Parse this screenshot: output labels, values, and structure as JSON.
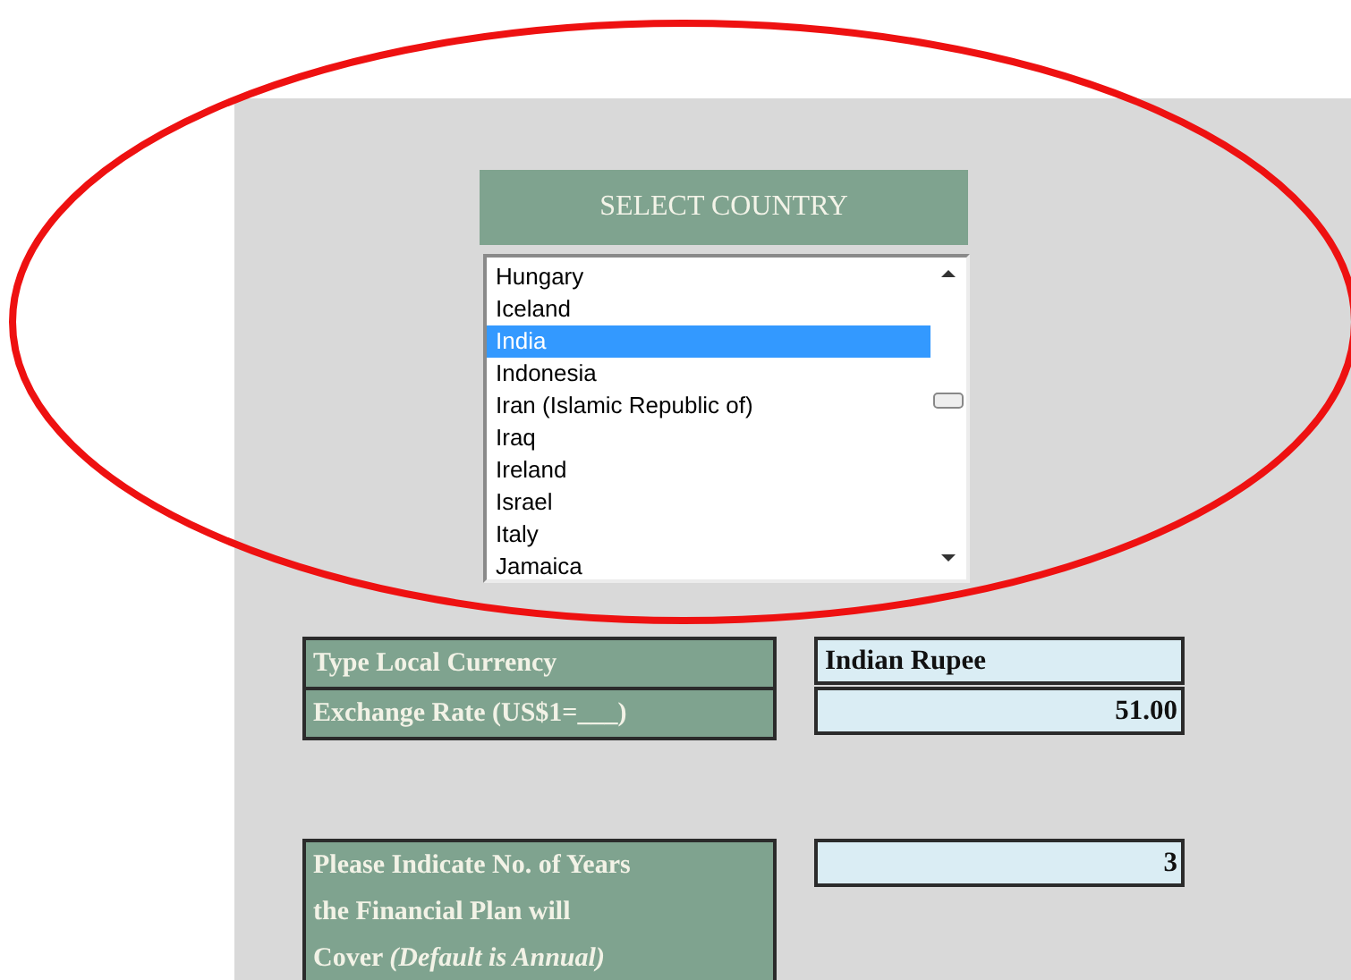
{
  "selector": {
    "title": "SELECT COUNTRY",
    "countries": [
      {
        "name": "Hungary",
        "selected": false
      },
      {
        "name": "Iceland",
        "selected": false
      },
      {
        "name": "India",
        "selected": true
      },
      {
        "name": "Indonesia",
        "selected": false
      },
      {
        "name": "Iran (Islamic Republic of)",
        "selected": false
      },
      {
        "name": "Iraq",
        "selected": false
      },
      {
        "name": "Ireland",
        "selected": false
      },
      {
        "name": "Israel",
        "selected": false
      },
      {
        "name": "Italy",
        "selected": false
      },
      {
        "name": "Jamaica",
        "selected": false
      }
    ]
  },
  "sections": [
    {
      "fields": [
        {
          "label_lines": [
            "Type Local Currency"
          ],
          "value": "Indian Rupee",
          "kind": "text"
        },
        {
          "label_lines": [
            "Exchange Rate (US$1=___)"
          ],
          "value": "51.00",
          "kind": "number"
        }
      ]
    },
    {
      "fields": [
        {
          "label_lines": [
            "Please Indicate No. of Years",
            "the Financial Plan will",
            "Cover *(Default is Annual)*"
          ],
          "value": "3",
          "kind": "number"
        }
      ]
    }
  ]
}
